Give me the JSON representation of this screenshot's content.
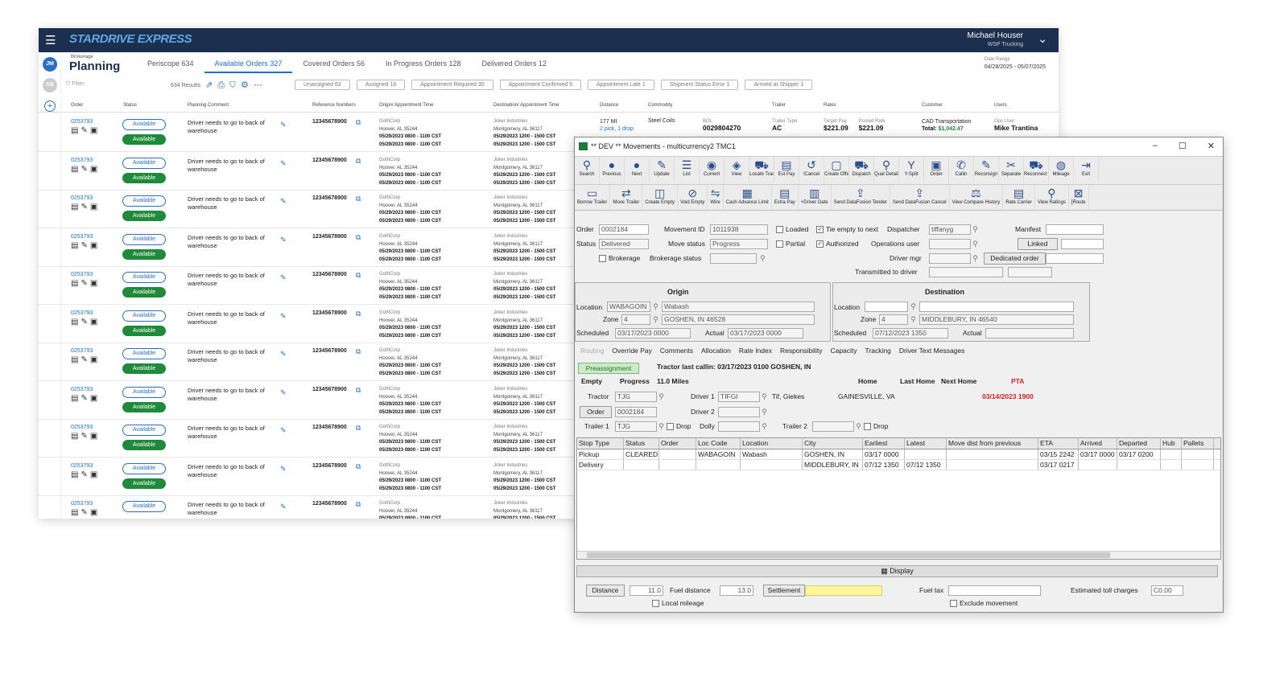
{
  "web": {
    "logo": "STARDRIVE EXPRESS",
    "user_name": "Michael Houser",
    "user_company": "WSP Trucking",
    "avatar1": "JM",
    "avatar2": "SB",
    "section_small": "Brokerage",
    "section_title": "Planning",
    "tabs": [
      {
        "label": "Periscope 634"
      },
      {
        "label": "Available Orders 327"
      },
      {
        "label": "Covered Orders 56"
      },
      {
        "label": "In Progress Orders 128"
      },
      {
        "label": "Delivered Orders 12"
      }
    ],
    "date_range_label": "Date Range",
    "date_range": "04/28/2025 - 05/07/2025",
    "filter_placeholder": "Filter",
    "results": "634 Results",
    "chips": [
      "Unassigned 63",
      "Assigned 16",
      "Appointment Required 30",
      "Appointment Confirmed 5",
      "Appointment Late 1",
      "Shipment Status Error 1",
      "Arrived at Shipper 1"
    ],
    "columns": [
      "Order",
      "Status",
      "Planning Comment",
      "Reference Numbers",
      "Origin/ Appointment Time",
      "Destination/ Appointment Time",
      "Distance",
      "Commodity",
      "Trailer",
      "Rates",
      "Customer",
      "Users"
    ],
    "row": {
      "order": "0253793",
      "status1": "Available",
      "status2": "Available",
      "comment": "Driver needs to go to back of warehouse",
      "ref": "12345678900",
      "origin_name": "GothCorp",
      "origin_city": "Hoover, AL 35244",
      "origin_t1": "05/29/2023 0800 - 1100 CST",
      "origin_t2": "05/29/2023 0800 - 1100 CST",
      "dest_name": "Joker Industries",
      "dest_city": "Montgomery, AL 36117",
      "dest_t1": "05/29/2023 1200 - 1500 CST",
      "dest_t2": "05/29/2023 1200 - 1500 CST"
    },
    "first_row": {
      "distance": "177 MI",
      "stops": "2 pick, 1 drop",
      "commodity": "Steel Coils",
      "bol_label": "BOL",
      "bol": "0029804270",
      "trailer_label": "Trailer Type",
      "trailer": "AC",
      "target_label": "Target Pay",
      "target": "$221.09",
      "posted_label": "Posted Rate",
      "posted": "$221.09",
      "customer": "CAD Transportation",
      "total_label": "Total:",
      "total": "$1,042.47",
      "ops_label": "Ops User",
      "ops": "Mike Trantina"
    }
  },
  "win": {
    "title": "** DEV ** Movements - multicurrency2 TMC1",
    "toolbar1": [
      {
        "label": "Search",
        "icon": "search-icon",
        "g": "⚲"
      },
      {
        "label": "Previous",
        "icon": "previous-icon",
        "g": "●"
      },
      {
        "label": "Next",
        "icon": "next-icon",
        "g": "●"
      },
      {
        "label": "Update",
        "icon": "update-icon",
        "g": "✎"
      },
      {
        "label": "List",
        "icon": "list-icon",
        "g": "☰"
      },
      {
        "label": "Current",
        "icon": "current-icon",
        "g": "◉"
      },
      {
        "label": "View",
        "icon": "view-icon",
        "g": "◈"
      },
      {
        "label": "Locate Tractor",
        "icon": "locate-tractor-icon",
        "g": "⛟"
      },
      {
        "label": "Est Pay",
        "icon": "est-pay-icon",
        "g": "▤"
      },
      {
        "label": "\\Cancel",
        "icon": "cancel-icon",
        "g": "↺"
      },
      {
        "label": "Create Offer",
        "icon": "create-offer-icon",
        "g": "▢"
      },
      {
        "label": "Dispatch",
        "icon": "dispatch-icon",
        "g": "⛟"
      },
      {
        "label": "Qual Details",
        "icon": "qual-details-icon",
        "g": "⚲"
      },
      {
        "label": "Y-Split",
        "icon": "y-split-icon",
        "g": "Y"
      },
      {
        "label": "Order",
        "icon": "order-icon",
        "g": "▣"
      },
      {
        "label": "Callin",
        "icon": "callin-icon",
        "g": "✆"
      },
      {
        "label": "Reconsign",
        "icon": "reconsign-icon",
        "g": "✎"
      },
      {
        "label": "Separate",
        "icon": "separate-icon",
        "g": "✂"
      },
      {
        "label": "Reconnect Stop",
        "icon": "reconnect-stop-icon",
        "g": "⛟"
      },
      {
        "label": "Mileage",
        "icon": "mileage-icon",
        "g": "◍"
      },
      {
        "label": "Exit",
        "icon": "exit-icon",
        "g": "⇥"
      }
    ],
    "toolbar2": [
      {
        "label": "Borrow Trailer",
        "icon": "borrow-trailer-icon",
        "g": "▭"
      },
      {
        "label": "Move Trailer",
        "icon": "move-trailer-icon",
        "g": "⇄"
      },
      {
        "label": "Create Empty",
        "icon": "create-empty-icon",
        "g": "◫"
      },
      {
        "label": "Void Empty",
        "icon": "void-empty-icon",
        "g": "⊘"
      },
      {
        "label": "Wire",
        "icon": "wire-icon",
        "g": "⇋"
      },
      {
        "label": "Cash Advance Limit",
        "icon": "cash-advance-icon",
        "g": "▦"
      },
      {
        "label": "Extra Pay",
        "icon": "extra-pay-icon",
        "g": "▤"
      },
      {
        "label": "+Driver Date",
        "icon": "driver-date-icon",
        "g": "▥"
      },
      {
        "label": "Send DataFusion Tender",
        "icon": "datafusion-tender-icon",
        "g": "⇪"
      },
      {
        "label": "Send DataFusion Cancel",
        "icon": "datafusion-cancel-icon",
        "g": "⇪"
      },
      {
        "label": "View Compare History",
        "icon": "compare-history-icon",
        "g": "⚖"
      },
      {
        "label": "Rate Carrier",
        "icon": "rate-carrier-icon",
        "g": "▤"
      },
      {
        "label": "View Ratings",
        "icon": "view-ratings-icon",
        "g": "⚲"
      },
      {
        "label": "[Route",
        "icon": "route-icon",
        "g": "⊠"
      }
    ],
    "order_label": "Order",
    "order": "0002184",
    "movement_label": "Movement ID",
    "movement": "1011938",
    "loaded_label": "Loaded",
    "tie_label": "Tie empty to next",
    "dispatcher_label": "Dispatcher",
    "dispatcher": "tiffanyg",
    "manifest_label": "Manifest",
    "status_label": "Status",
    "status": "Delivered",
    "move_status_label": "Move status",
    "move_status": "Progress",
    "partial_label": "Partial",
    "authorized_label": "Authorized",
    "ops_user_label": "Operations user",
    "linked_label": "Linked",
    "brokerage_label": "Brokerage",
    "brokerage_status_label": "Brokerage status",
    "driver_mgr_label": "Driver mgr",
    "dedicated_label": "Dedicated order",
    "transmitted_label": "Transmitted to driver",
    "origin_title": "Origin",
    "dest_title": "Destination",
    "location_label": "Location",
    "o_loc": "WABAGOIN",
    "o_loc_name": "Wabash",
    "zone_label": "Zone",
    "o_zone": "4",
    "o_city": "GOSHEN, IN 46528",
    "scheduled_label": "Scheduled",
    "o_sched": "03/17/2023 0000",
    "actual_label": "Actual",
    "o_actual": "03/17/2023 0000",
    "d_zone": "4",
    "d_city": "MIDDLEBURY, IN 46540",
    "d_sched": "07/12/2023 1350",
    "rtabs": [
      "Routing",
      "Override Pay",
      "Comments",
      "Allocation",
      "Rate Index",
      "Responsibility",
      "Capacity",
      "Tracking",
      "Driver Text Messages"
    ],
    "preassign": "Preassignment",
    "last_callin": "Tractor last callin: 03/17/2023 0100  GOSHEN, IN",
    "empty_label": "Empty",
    "progress_label": "Progress",
    "miles": "11.0 Miles",
    "home_label": "Home",
    "last_home_label": "Last Home",
    "next_home_label": "Next Home",
    "pta_label": "PTA",
    "tractor_label": "Tractor",
    "tractor": "TJG",
    "driver1_label": "Driver 1",
    "driver1": "TIFGI",
    "driver1_name": "Tif, Giekes",
    "driver1_home": "GAINESVILLE, VA",
    "pta": "03/14/2023 1900",
    "order_btn": "Order",
    "order2": "0002184",
    "driver2_label": "Driver 2",
    "trailer1_label": "Trailer 1",
    "trailer1": "TJG",
    "drop_label": "Drop",
    "dolly_label": "Dolly",
    "trailer2_label": "Trailer 2",
    "grid_cols": [
      "Stop Type",
      "Status",
      "Order",
      "Loc Code",
      "Location",
      "City",
      "Earliest",
      "Latest",
      "Move dist from previous",
      "ETA",
      "Arrived",
      "Departed",
      "Hub",
      "Pallets"
    ],
    "grid_rows": [
      [
        "Pickup",
        "CLEARED",
        "",
        "WABAGOIN",
        "Wabash",
        "GOSHEN, IN",
        "03/17 0000",
        "",
        "",
        "03/15 2242",
        "03/17 0000",
        "03/17 0200",
        "",
        ""
      ],
      [
        "Delivery",
        "",
        "",
        "",
        "",
        "MIDDLEBURY, IN",
        "07/12 1350",
        "07/12 1350",
        "",
        "03/17 0217",
        "",
        "",
        "",
        ""
      ]
    ],
    "display_label": "Display",
    "distance_btn": "Distance",
    "distance": "11.0",
    "fuel_distance_label": "Fuel distance",
    "fuel_distance": "13.0",
    "settlement_label": "Settlement",
    "settlement_color": "#fff59a",
    "fuel_tax_label": "Fuel tax",
    "toll_label": "Estimated toll charges",
    "toll": "C0.00",
    "local_mileage_label": "Local mileage",
    "exclude_label": "Exclude movement"
  }
}
